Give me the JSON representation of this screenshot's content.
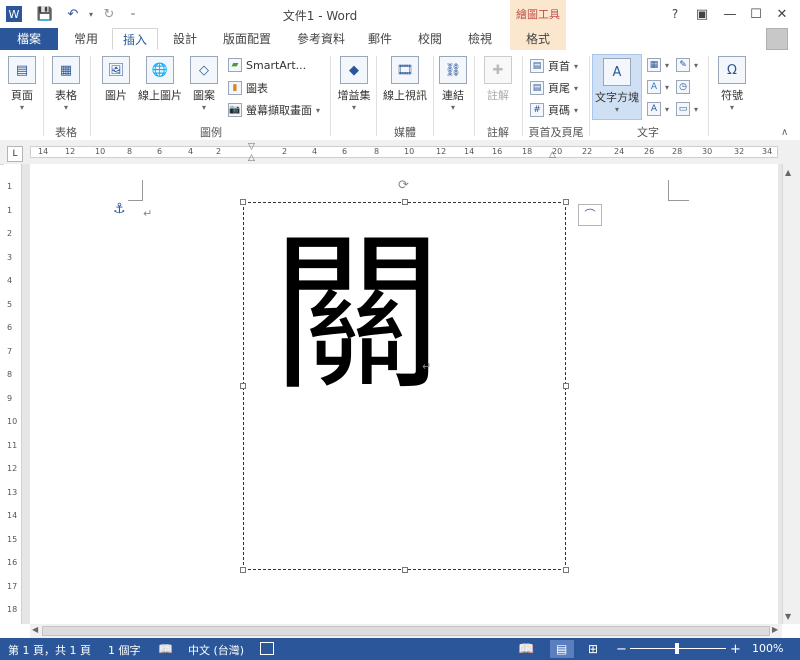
{
  "app": {
    "title": "文件1 - Word",
    "tools_header": "繪圖工具",
    "help": "?",
    "colors": {
      "accent": "#2b579a",
      "tools": "#c0504d",
      "tools_bg": "#fbe7cd"
    }
  },
  "tabs": [
    {
      "label": "檔案"
    },
    {
      "label": "常用"
    },
    {
      "label": "插入"
    },
    {
      "label": "設計"
    },
    {
      "label": "版面配置"
    },
    {
      "label": "參考資料"
    },
    {
      "label": "郵件"
    },
    {
      "label": "校閱"
    },
    {
      "label": "檢視"
    },
    {
      "label": "格式"
    }
  ],
  "ribbon": {
    "page": {
      "label": "頁面"
    },
    "table": {
      "label": "表格",
      "group": "表格"
    },
    "pictures": {
      "label": "圖片"
    },
    "online_pictures": {
      "label": "線上圖片"
    },
    "shapes": {
      "label": "圖案"
    },
    "smartart": {
      "label": "SmartArt..."
    },
    "chart": {
      "label": "圖表"
    },
    "screenshot": {
      "label": "螢幕擷取畫面"
    },
    "illustrations_group": "圖例",
    "addins": {
      "label": "增益集"
    },
    "online_video": {
      "label": "線上視訊",
      "group": "媒體"
    },
    "links": {
      "label": "連結"
    },
    "comment": {
      "label": "註解",
      "group": "註解"
    },
    "header": {
      "label": "頁首"
    },
    "footer": {
      "label": "頁尾"
    },
    "page_number": {
      "label": "頁碼"
    },
    "header_footer_group": "頁首及頁尾",
    "textbox": {
      "label": "文字方塊"
    },
    "text_group": "文字",
    "symbols": {
      "label": "符號"
    }
  },
  "ruler": {
    "h_ticks": [
      "14",
      "12",
      "10",
      "8",
      "6",
      "4",
      "2",
      "2",
      "4",
      "6",
      "8",
      "10",
      "12",
      "14",
      "16",
      "18",
      "20",
      "22",
      "24",
      "26",
      "28",
      "30",
      "32",
      "34"
    ],
    "v_ticks": [
      "1",
      "1",
      "2",
      "3",
      "4",
      "5",
      "6",
      "7",
      "8",
      "9",
      "10",
      "11",
      "12",
      "13",
      "14",
      "15",
      "16",
      "17",
      "18"
    ],
    "corner": "L"
  },
  "document": {
    "character": "關",
    "paragraph_mark": "↵"
  },
  "status": {
    "page": "第 1 頁，共 1 頁",
    "words": "1 個字",
    "language": "中文 (台灣)",
    "zoom_minus": "−",
    "zoom_plus": "+",
    "zoom": "100%"
  }
}
